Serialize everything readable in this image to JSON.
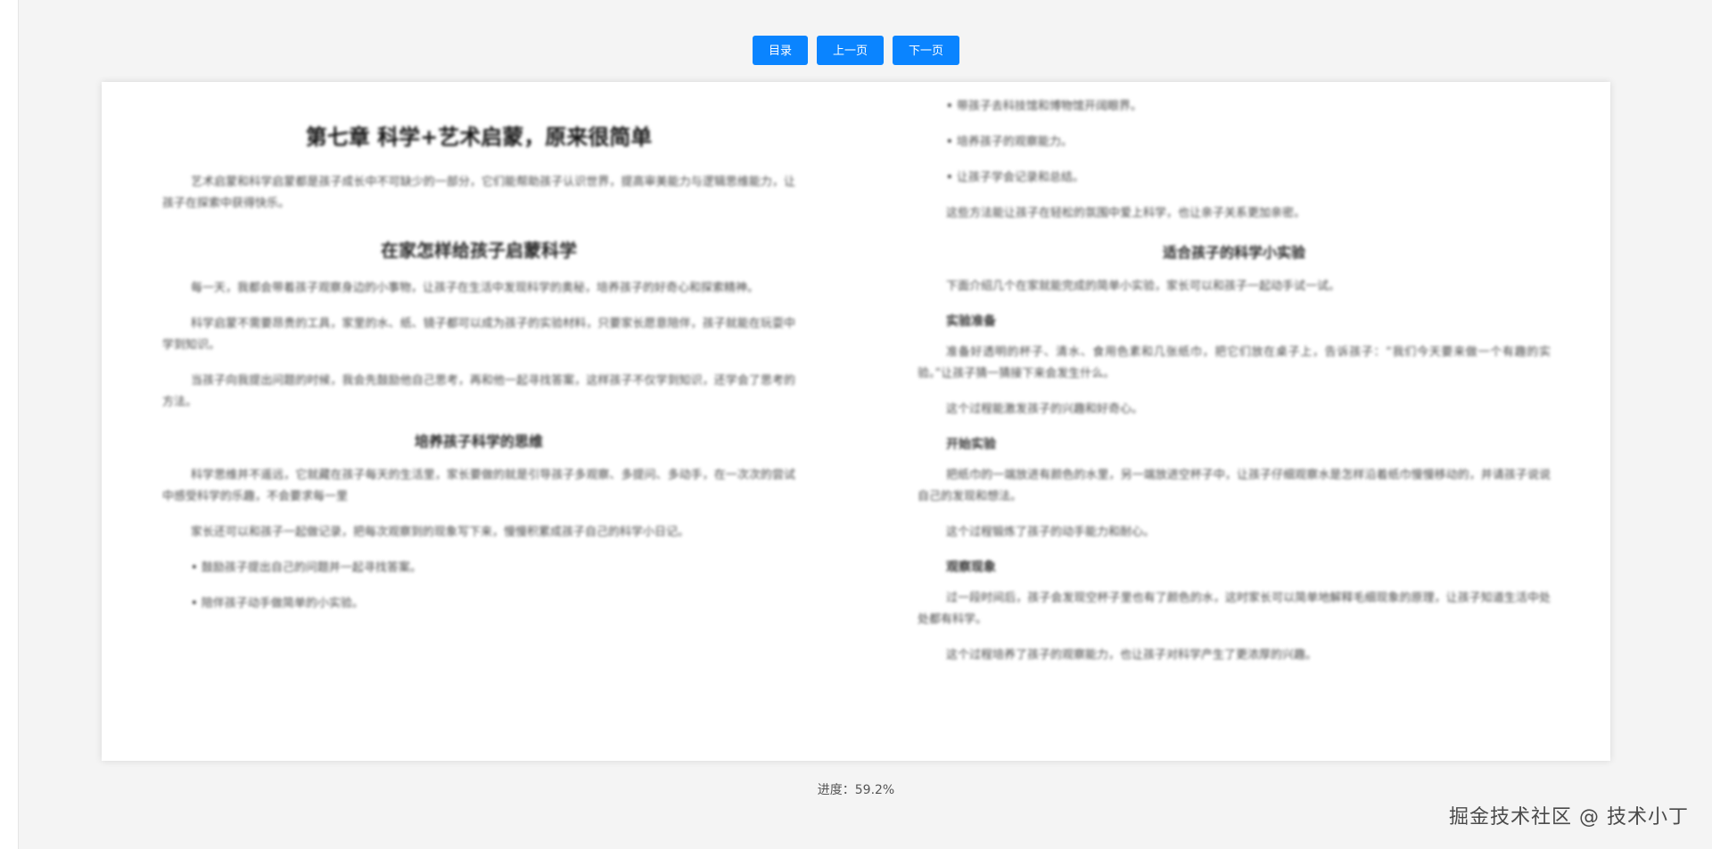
{
  "toolbar": {
    "toc_label": "目录",
    "prev_label": "上一页",
    "next_label": "下一页",
    "accent_color": "#0a84ff"
  },
  "page": {
    "left": {
      "chapter_title": "第七章 科学+艺术启蒙，原来很简单",
      "intro": "艺术启蒙和科学启蒙都是孩子成长中不可缺少的一部分，它们能帮助孩子认识世界，提高审美能力与逻辑思维能力，让孩子在探索中获得快乐。",
      "section_title": "在家怎样给孩子启蒙科学",
      "section_paras": [
        "每一天，我都会带着孩子观察身边的小事物，让孩子在生活中发现科学的奥秘，培养孩子的好奇心和探索精神。",
        "科学启蒙不需要昂贵的工具，家里的水、纸、镜子都可以成为孩子的实验材料，只要家长愿意陪伴，孩子就能在玩耍中学到知识。",
        "当孩子向我提出问题的时候，我会先鼓励他自己思考，再和他一起寻找答案，这样孩子不仅学到知识，还学会了思考的方法。"
      ],
      "sub_title": "培养孩子科学的思维",
      "sub_paras": [
        "科学思维并不遥远，它就藏在孩子每天的生活里，家长要做的就是引导孩子多观察、多提问、多动手，在一次次的尝试中感受科学的乐趣，不会要求每一里",
        "家长还可以和孩子一起做记录，把每次观察到的现象写下来，慢慢积累成孩子自己的科学小日记。"
      ],
      "bullets": [
        "鼓励孩子提出自己的问题并一起寻找答案。",
        "陪伴孩子动手做简单的小实验。"
      ]
    },
    "right": {
      "bullets": [
        "带孩子去科技馆和博物馆开阔眼界。",
        "培养孩子的观察能力。",
        "让孩子学会记录和总结。"
      ],
      "after_bullets": "这些方法能让孩子在轻松的氛围中爱上科学，也让亲子关系更加亲密。",
      "sub_title": "适合孩子的科学小实验",
      "intro": "下面介绍几个在家就能完成的简单小实验，家长可以和孩子一起动手试一试。",
      "heads": [
        "实验准备",
        "开始实验",
        "观察现象"
      ],
      "paras": [
        "准备好透明的杯子、清水、食用色素和几张纸巾，把它们放在桌子上，告诉孩子：“我们今天要来做一个有趣的实验。”让孩子猜一猜接下来会发生什么。",
        "这个过程能激发孩子的兴趣和好奇心。",
        "把纸巾的一端放进有颜色的水里，另一端放进空杯子中，让孩子仔细观察水是怎样沿着纸巾慢慢移动的，并请孩子说说自己的发现和想法。",
        "这个过程锻炼了孩子的动手能力和耐心。",
        "过一段时间后，孩子会发现空杯子里也有了颜色的水，这时家长可以简单地解释毛细现象的原理，让孩子知道生活中处处都有科学。",
        "这个过程培养了孩子的观察能力，也让孩子对科学产生了更浓厚的兴趣。"
      ]
    }
  },
  "progress": {
    "label": "进度：",
    "value": "59.2%"
  },
  "watermark": "掘金技术社区 @ 技术小丁"
}
